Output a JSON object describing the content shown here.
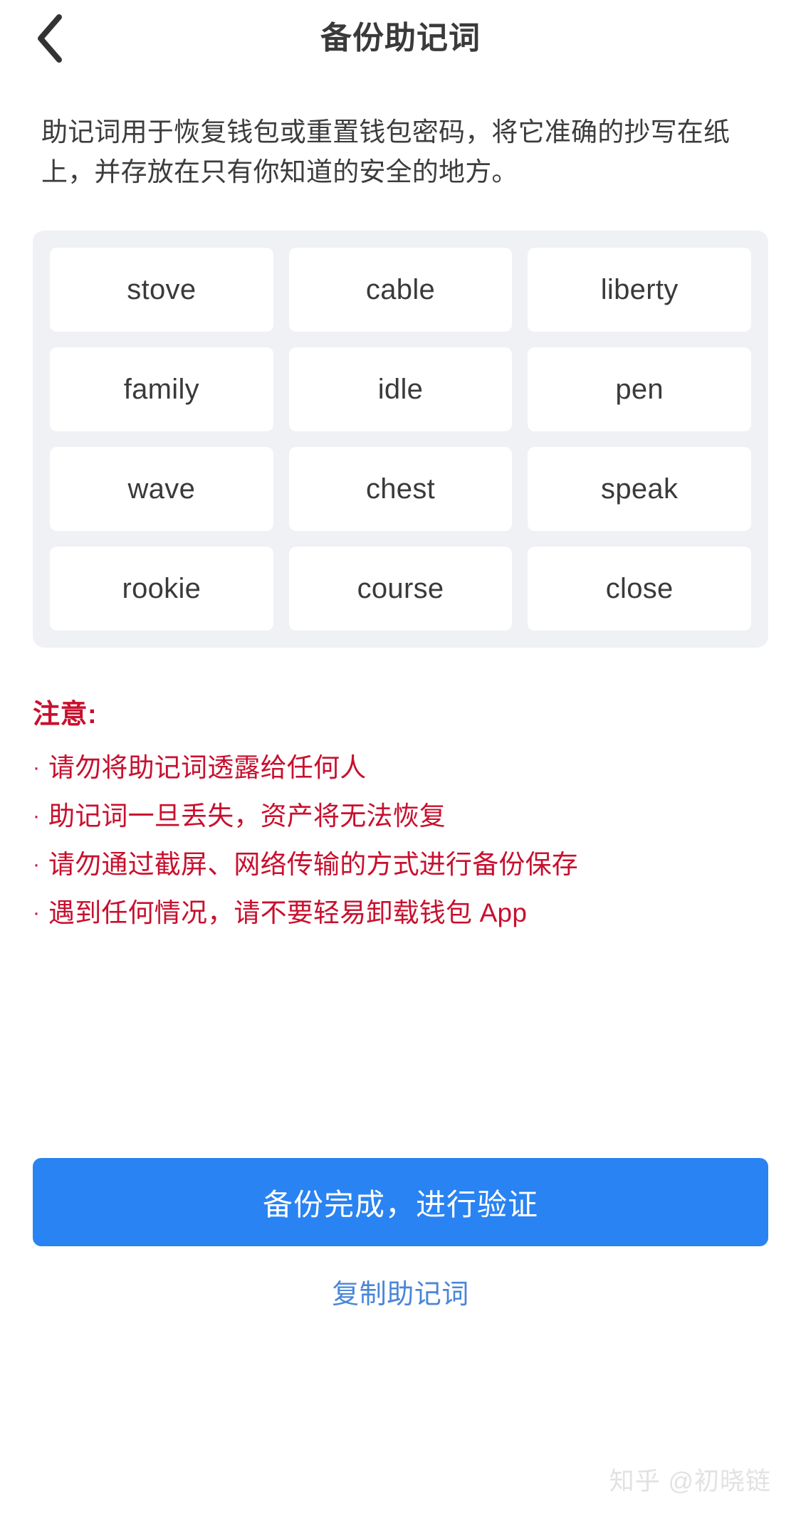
{
  "header": {
    "title": "备份助记词",
    "back_icon": "chevron-left-icon"
  },
  "description": "助记词用于恢复钱包或重置钱包密码，将它准确的抄写在纸上，并存放在只有你知道的安全的地方。",
  "mnemonic": {
    "words": [
      "stove",
      "cable",
      "liberty",
      "family",
      "idle",
      "pen",
      "wave",
      "chest",
      "speak",
      "rookie",
      "course",
      "close"
    ],
    "columns": 3,
    "panel_bg": "#f0f1f5",
    "card_bg": "#ffffff"
  },
  "notice": {
    "title": "注意:",
    "color": "#c8102e",
    "bullet": "·",
    "items": [
      "请勿将助记词透露给任何人",
      "助记词一旦丢失，资产将无法恢复",
      "请勿通过截屏、网络传输的方式进行备份保存",
      "遇到任何情况，请不要轻易卸载钱包 App"
    ]
  },
  "actions": {
    "primary_label": "备份完成，进行验证",
    "primary_color": "#2a83f2",
    "secondary_label": "复制助记词",
    "secondary_color": "#4a86d8"
  },
  "watermark": "知乎 @初晓链"
}
